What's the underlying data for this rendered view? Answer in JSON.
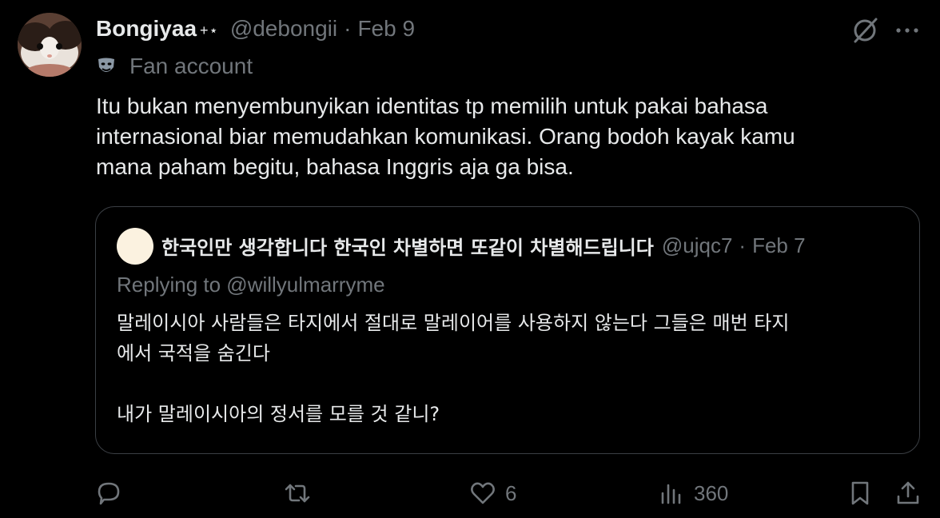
{
  "author": {
    "display_name": "Bongiyaa",
    "badge": "+⋆",
    "handle": "@debongii",
    "separator": "·",
    "date": "Feb 9",
    "label": "Fan account"
  },
  "tweet": {
    "text_lines": [
      "Itu bukan menyembunyikan identitas tp memilih untuk pakai bahasa",
      "internasional biar memudahkan komunikasi. Orang bodoh kayak kamu",
      "mana paham begitu, bahasa Inggris aja ga bisa."
    ]
  },
  "quote": {
    "display_name": "한국인만 생각합니다 한국인 차별하면 또같이 차별해드립니다",
    "handle": "@ujqc7",
    "separator": "·",
    "date": "Feb 7",
    "replying_to": "Replying to @willyulmarryme",
    "text_lines": [
      "말레이시아 사람들은 타지에서 절대로 말레이어를 사용하지 않는다 그들은 매번 타지",
      "에서 국적을 숨긴다",
      "",
      "내가 말레이시아의 정서를 모를 것 같니?"
    ]
  },
  "actions": {
    "replies": "",
    "reposts": "",
    "likes": "6",
    "views": "360"
  },
  "icons": {
    "label_icon": "theater-masks-icon",
    "reply": "speech-bubble-icon",
    "repost": "repost-arrows-icon",
    "like": "heart-icon",
    "views": "bar-chart-icon",
    "bookmark": "bookmark-icon",
    "share": "share-upload-icon",
    "grok": "grok-slash-icon",
    "more": "ellipsis-icon"
  },
  "colors": {
    "background": "#000000",
    "primary_text": "#e7e9ea",
    "secondary_text": "#71767b",
    "border": "#3b3f44"
  }
}
